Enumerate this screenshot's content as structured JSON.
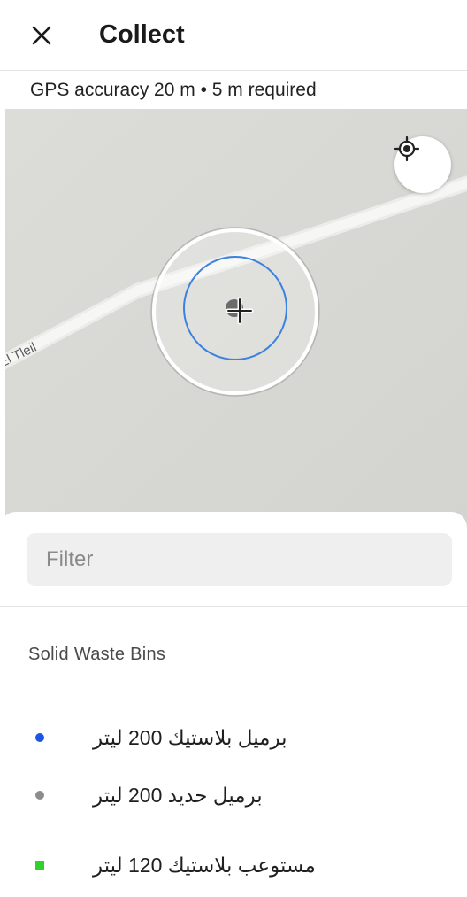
{
  "header": {
    "title": "Collect",
    "close_icon": "close-icon"
  },
  "gps": {
    "status_text": "GPS accuracy 20 m  •  5 m required"
  },
  "map": {
    "road_label": "El Tleil",
    "locate_icon": "my-location-icon",
    "crosshair_icon": "crosshair-icon",
    "accuracy_circle_color": "#3b82e0"
  },
  "filter": {
    "placeholder": "Filter",
    "value": ""
  },
  "section": {
    "title": "Solid Waste Bins"
  },
  "layers": [
    {
      "label": "برميل بلاستيك 200 ليتر",
      "symbol": "circle",
      "color": "#1a56e6"
    },
    {
      "label": "برميل حديد 200 ليتر",
      "symbol": "circle",
      "color": "#8c8c8c"
    },
    {
      "label": "مستوعب بلاستيك 120 ليتر",
      "symbol": "square",
      "color": "#2ed12e"
    }
  ]
}
